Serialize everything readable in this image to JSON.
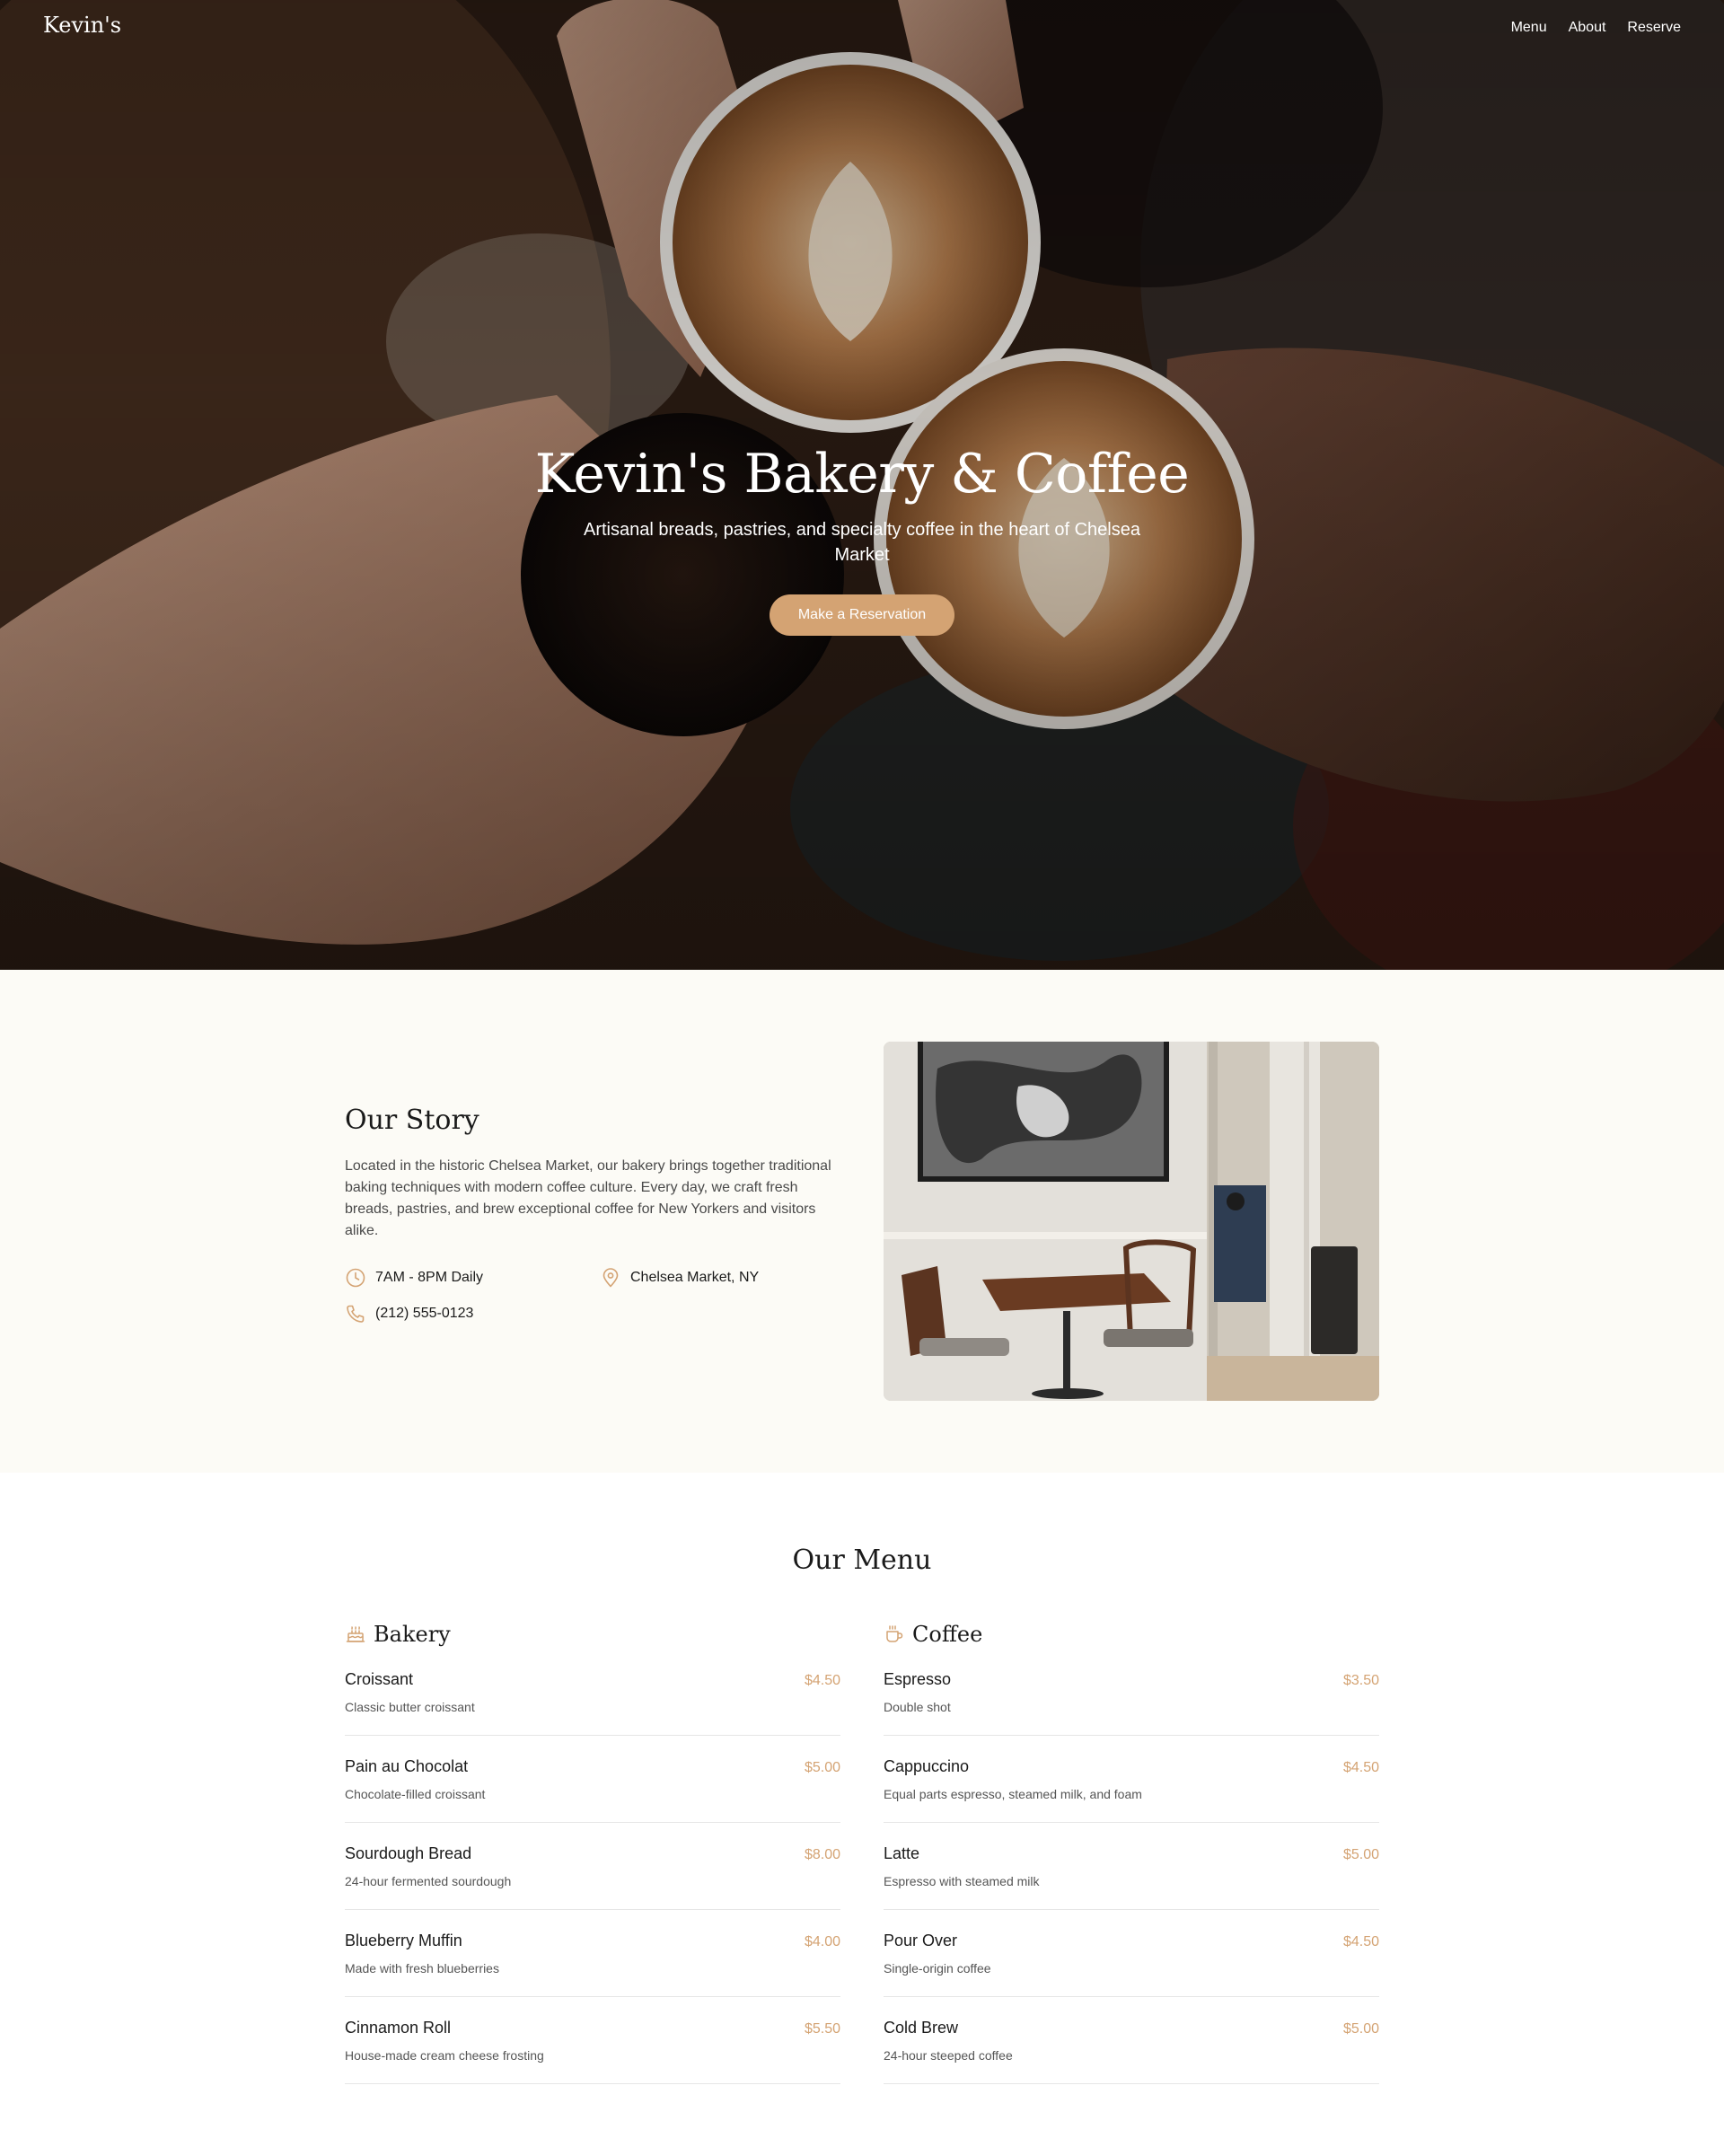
{
  "nav": {
    "brand": "Kevin's",
    "links": [
      "Menu",
      "About",
      "Reserve"
    ]
  },
  "hero": {
    "title": "Kevin's Bakery & Coffee",
    "subtitle": "Artisanal breads, pastries, and specialty coffee in the heart of Chelsea Market",
    "cta": "Make a Reservation"
  },
  "story": {
    "title": "Our Story",
    "body": "Located in the historic Chelsea Market, our bakery brings together traditional baking techniques with modern coffee culture. Every day, we craft fresh breads, pastries, and brew exceptional coffee for New Yorkers and visitors alike.",
    "hours": "7AM - 8PM Daily",
    "location": "Chelsea Market, NY",
    "phone": "(212) 555-0123"
  },
  "menu": {
    "title": "Our Menu",
    "bakery": {
      "title": "Bakery",
      "items": [
        {
          "name": "Croissant",
          "price": "$4.50",
          "desc": "Classic butter croissant"
        },
        {
          "name": "Pain au Chocolat",
          "price": "$5.00",
          "desc": "Chocolate-filled croissant"
        },
        {
          "name": "Sourdough Bread",
          "price": "$8.00",
          "desc": "24-hour fermented sourdough"
        },
        {
          "name": "Blueberry Muffin",
          "price": "$4.00",
          "desc": "Made with fresh blueberries"
        },
        {
          "name": "Cinnamon Roll",
          "price": "$5.50",
          "desc": "House-made cream cheese frosting"
        }
      ]
    },
    "coffee": {
      "title": "Coffee",
      "items": [
        {
          "name": "Espresso",
          "price": "$3.50",
          "desc": "Double shot"
        },
        {
          "name": "Cappuccino",
          "price": "$4.50",
          "desc": "Equal parts espresso, steamed milk, and foam"
        },
        {
          "name": "Latte",
          "price": "$5.00",
          "desc": "Espresso with steamed milk"
        },
        {
          "name": "Pour Over",
          "price": "$4.50",
          "desc": "Single-origin coffee"
        },
        {
          "name": "Cold Brew",
          "price": "$5.00",
          "desc": "24-hour steeped coffee"
        }
      ]
    }
  },
  "colors": {
    "accent": "#d4a373",
    "story_bg": "#fcfbf6"
  }
}
